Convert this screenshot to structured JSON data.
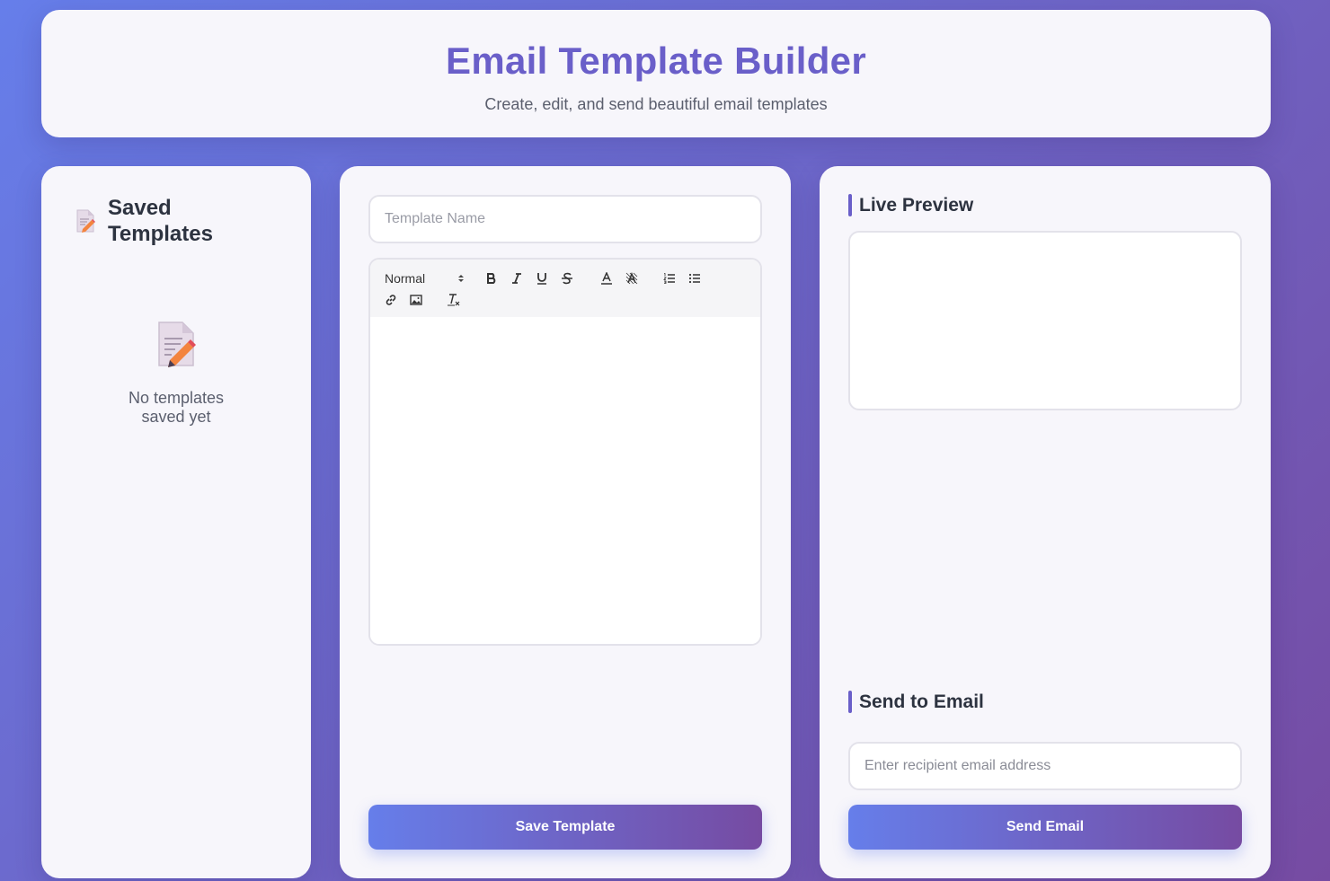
{
  "header": {
    "title": "Email Template Builder",
    "subtitle": "Create, edit, and send beautiful email templates"
  },
  "sidebar": {
    "title": "Saved Templates",
    "title_icon": "memo-icon",
    "empty_icon": "memo-icon",
    "empty_text_line1": "No templates",
    "empty_text_line2": "saved yet"
  },
  "editor": {
    "template_name_placeholder": "Template Name",
    "template_name_value": "",
    "toolbar": {
      "header_select_value": "Normal",
      "buttons": [
        "bold-icon",
        "italic-icon",
        "underline-icon",
        "strikethrough-icon",
        "text-color-icon",
        "background-color-icon",
        "ordered-list-icon",
        "bullet-list-icon",
        "link-icon",
        "image-icon",
        "clear-format-icon"
      ]
    },
    "content": "",
    "save_label": "Save Template"
  },
  "preview": {
    "title": "Live Preview",
    "content": ""
  },
  "send": {
    "title": "Send to Email",
    "email_placeholder": "Enter recipient email address",
    "email_value": "",
    "send_label": "Send Email"
  },
  "colors": {
    "accent": "#6a5fc9",
    "gradient_start": "#667eea",
    "gradient_end": "#764ba2"
  }
}
